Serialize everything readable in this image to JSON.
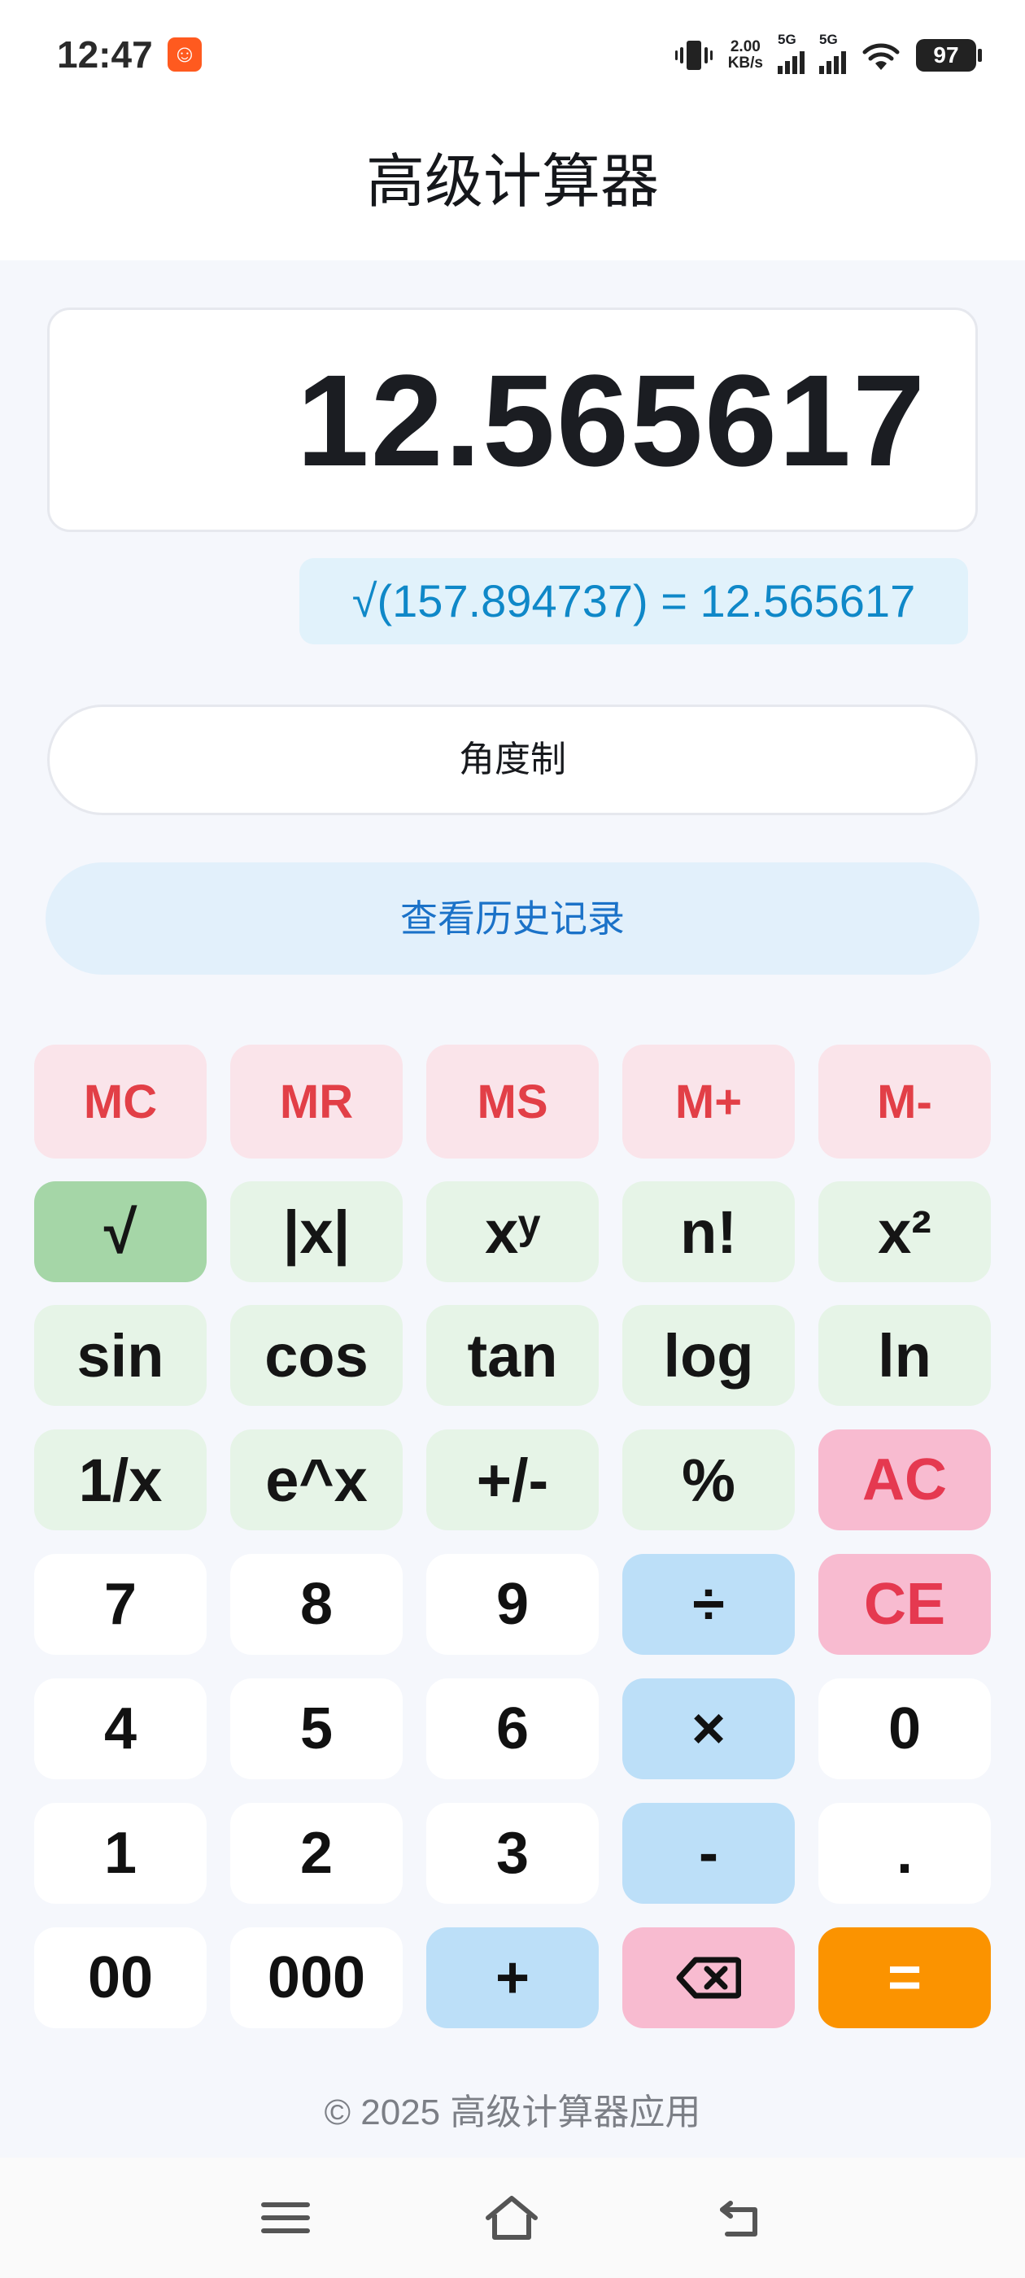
{
  "status": {
    "time": "12:47",
    "app_badge_icon": "app-notification-icon",
    "net_speed_value": "2.00",
    "net_speed_unit": "KB/s",
    "signal1_label": "5G",
    "signal2_label": "5G",
    "battery": "97"
  },
  "header": {
    "title": "高级计算器"
  },
  "display": {
    "value": "12.565617",
    "expression": "√(157.894737) = 12.565617"
  },
  "mode_button": "角度制",
  "history_button": "查看历史记录",
  "keys": {
    "row1": [
      "MC",
      "MR",
      "MS",
      "M+",
      "M-"
    ],
    "row2": [
      "√",
      "|x|",
      "xʸ",
      "n!",
      "x²"
    ],
    "row3": [
      "sin",
      "cos",
      "tan",
      "log",
      "ln"
    ],
    "row4": [
      "1/x",
      "e^x",
      "+/-",
      "%",
      "AC"
    ],
    "row5": [
      "7",
      "8",
      "9",
      "÷",
      "CE"
    ],
    "row6": [
      "4",
      "5",
      "6",
      "×",
      "0"
    ],
    "row7": [
      "1",
      "2",
      "3",
      "-",
      "."
    ],
    "row8": [
      "00",
      "000",
      "+",
      "",
      "="
    ]
  },
  "backspace_icon": "backspace-icon",
  "footer": "© 2025 高级计算器应用",
  "colors": {
    "accent_equals": "#fb9300",
    "memory_text": "#e23f47",
    "function_bg": "#e6f4e7",
    "active_function_bg": "#a5d6a7",
    "operator_bg": "#bcdff8",
    "clear_bg": "#f8bbd0",
    "expression_text": "#0f88c8",
    "history_text": "#1b72c8"
  }
}
